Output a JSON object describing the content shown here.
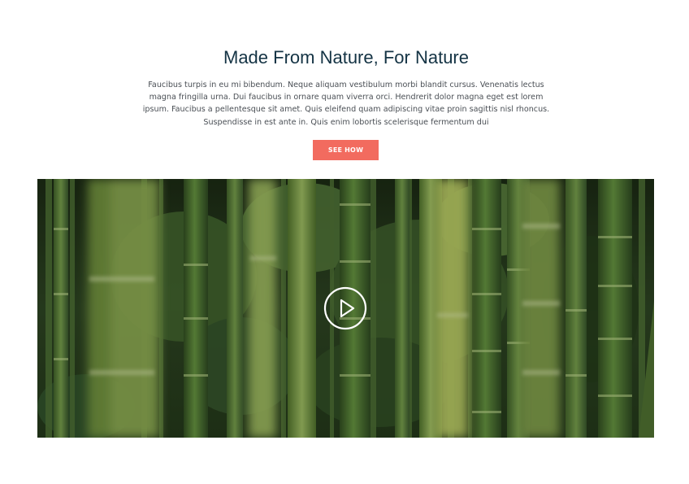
{
  "hero": {
    "title": "Made From Nature, For Nature",
    "description": "Faucibus turpis in eu mi bibendum. Neque aliquam vestibulum morbi blandit cursus. Venenatis lectus magna fringilla urna. Dui faucibus in ornare quam viverra orci. Hendrerit dolor magna eget est lorem ipsum. Faucibus a pellentesque sit amet. Quis eleifend quam adipiscing vitae proin sagittis nisl rhoncus. Suspendisse in est ante in. Quis enim lobortis scelerisque fermentum dui",
    "cta_label": "SEE HOW"
  },
  "video": {
    "icon": "play-icon",
    "colors": {
      "foliage_dark": "#1f3318",
      "stalk_mid": "#4f7a32",
      "stalk_light": "#8fb05a"
    }
  },
  "colors": {
    "title": "#143344",
    "text": "#4a4f55",
    "accent": "#f26b5f"
  }
}
